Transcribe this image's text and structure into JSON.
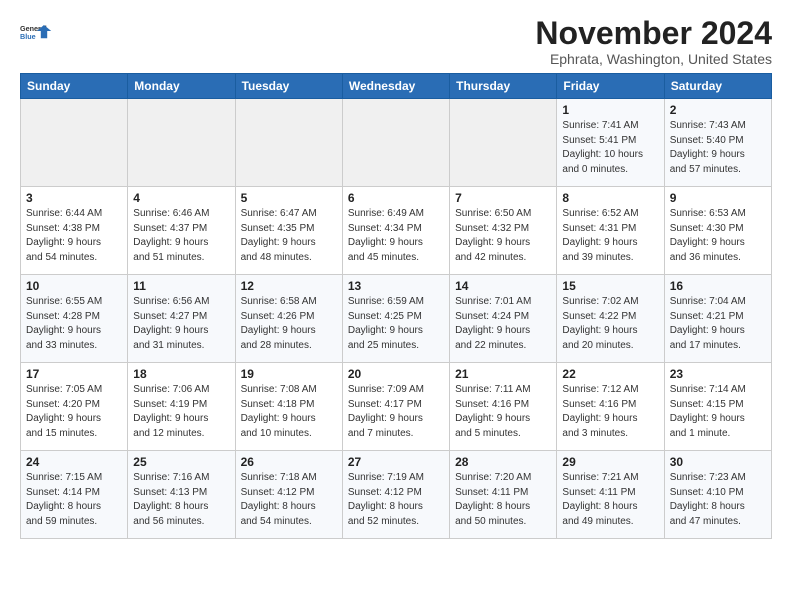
{
  "header": {
    "logo_line1": "General",
    "logo_line2": "Blue",
    "main_title": "November 2024",
    "subtitle": "Ephrata, Washington, United States"
  },
  "days_of_week": [
    "Sunday",
    "Monday",
    "Tuesday",
    "Wednesday",
    "Thursday",
    "Friday",
    "Saturday"
  ],
  "weeks": [
    [
      {
        "day": "",
        "info": ""
      },
      {
        "day": "",
        "info": ""
      },
      {
        "day": "",
        "info": ""
      },
      {
        "day": "",
        "info": ""
      },
      {
        "day": "",
        "info": ""
      },
      {
        "day": "1",
        "info": "Sunrise: 7:41 AM\nSunset: 5:41 PM\nDaylight: 10 hours\nand 0 minutes."
      },
      {
        "day": "2",
        "info": "Sunrise: 7:43 AM\nSunset: 5:40 PM\nDaylight: 9 hours\nand 57 minutes."
      }
    ],
    [
      {
        "day": "3",
        "info": "Sunrise: 6:44 AM\nSunset: 4:38 PM\nDaylight: 9 hours\nand 54 minutes."
      },
      {
        "day": "4",
        "info": "Sunrise: 6:46 AM\nSunset: 4:37 PM\nDaylight: 9 hours\nand 51 minutes."
      },
      {
        "day": "5",
        "info": "Sunrise: 6:47 AM\nSunset: 4:35 PM\nDaylight: 9 hours\nand 48 minutes."
      },
      {
        "day": "6",
        "info": "Sunrise: 6:49 AM\nSunset: 4:34 PM\nDaylight: 9 hours\nand 45 minutes."
      },
      {
        "day": "7",
        "info": "Sunrise: 6:50 AM\nSunset: 4:32 PM\nDaylight: 9 hours\nand 42 minutes."
      },
      {
        "day": "8",
        "info": "Sunrise: 6:52 AM\nSunset: 4:31 PM\nDaylight: 9 hours\nand 39 minutes."
      },
      {
        "day": "9",
        "info": "Sunrise: 6:53 AM\nSunset: 4:30 PM\nDaylight: 9 hours\nand 36 minutes."
      }
    ],
    [
      {
        "day": "10",
        "info": "Sunrise: 6:55 AM\nSunset: 4:28 PM\nDaylight: 9 hours\nand 33 minutes."
      },
      {
        "day": "11",
        "info": "Sunrise: 6:56 AM\nSunset: 4:27 PM\nDaylight: 9 hours\nand 31 minutes."
      },
      {
        "day": "12",
        "info": "Sunrise: 6:58 AM\nSunset: 4:26 PM\nDaylight: 9 hours\nand 28 minutes."
      },
      {
        "day": "13",
        "info": "Sunrise: 6:59 AM\nSunset: 4:25 PM\nDaylight: 9 hours\nand 25 minutes."
      },
      {
        "day": "14",
        "info": "Sunrise: 7:01 AM\nSunset: 4:24 PM\nDaylight: 9 hours\nand 22 minutes."
      },
      {
        "day": "15",
        "info": "Sunrise: 7:02 AM\nSunset: 4:22 PM\nDaylight: 9 hours\nand 20 minutes."
      },
      {
        "day": "16",
        "info": "Sunrise: 7:04 AM\nSunset: 4:21 PM\nDaylight: 9 hours\nand 17 minutes."
      }
    ],
    [
      {
        "day": "17",
        "info": "Sunrise: 7:05 AM\nSunset: 4:20 PM\nDaylight: 9 hours\nand 15 minutes."
      },
      {
        "day": "18",
        "info": "Sunrise: 7:06 AM\nSunset: 4:19 PM\nDaylight: 9 hours\nand 12 minutes."
      },
      {
        "day": "19",
        "info": "Sunrise: 7:08 AM\nSunset: 4:18 PM\nDaylight: 9 hours\nand 10 minutes."
      },
      {
        "day": "20",
        "info": "Sunrise: 7:09 AM\nSunset: 4:17 PM\nDaylight: 9 hours\nand 7 minutes."
      },
      {
        "day": "21",
        "info": "Sunrise: 7:11 AM\nSunset: 4:16 PM\nDaylight: 9 hours\nand 5 minutes."
      },
      {
        "day": "22",
        "info": "Sunrise: 7:12 AM\nSunset: 4:16 PM\nDaylight: 9 hours\nand 3 minutes."
      },
      {
        "day": "23",
        "info": "Sunrise: 7:14 AM\nSunset: 4:15 PM\nDaylight: 9 hours\nand 1 minute."
      }
    ],
    [
      {
        "day": "24",
        "info": "Sunrise: 7:15 AM\nSunset: 4:14 PM\nDaylight: 8 hours\nand 59 minutes."
      },
      {
        "day": "25",
        "info": "Sunrise: 7:16 AM\nSunset: 4:13 PM\nDaylight: 8 hours\nand 56 minutes."
      },
      {
        "day": "26",
        "info": "Sunrise: 7:18 AM\nSunset: 4:12 PM\nDaylight: 8 hours\nand 54 minutes."
      },
      {
        "day": "27",
        "info": "Sunrise: 7:19 AM\nSunset: 4:12 PM\nDaylight: 8 hours\nand 52 minutes."
      },
      {
        "day": "28",
        "info": "Sunrise: 7:20 AM\nSunset: 4:11 PM\nDaylight: 8 hours\nand 50 minutes."
      },
      {
        "day": "29",
        "info": "Sunrise: 7:21 AM\nSunset: 4:11 PM\nDaylight: 8 hours\nand 49 minutes."
      },
      {
        "day": "30",
        "info": "Sunrise: 7:23 AM\nSunset: 4:10 PM\nDaylight: 8 hours\nand 47 minutes."
      }
    ]
  ]
}
